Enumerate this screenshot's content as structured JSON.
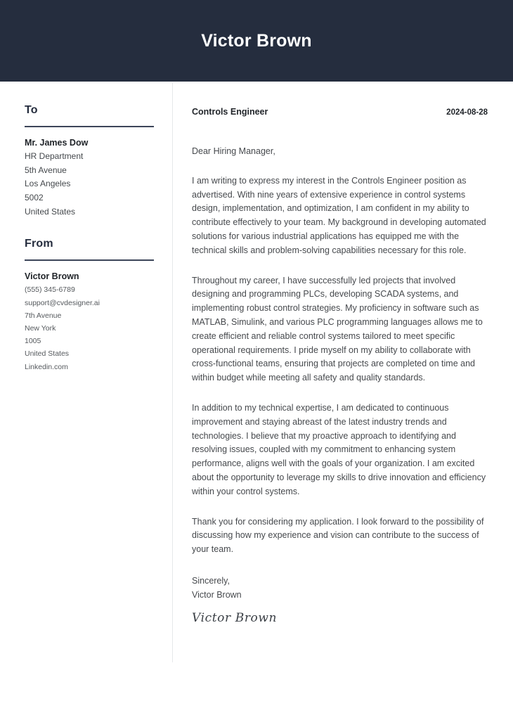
{
  "header": {
    "name": "Victor Brown"
  },
  "sidebar": {
    "to": {
      "heading": "To",
      "lines": [
        "Mr. James Dow",
        "HR Department",
        "5th Avenue",
        "Los Angeles",
        "5002",
        "United States"
      ]
    },
    "from": {
      "heading": "From",
      "name": "Victor Brown",
      "lines": [
        "(555) 345-6789",
        "support@cvdesigner.ai",
        "7th Avenue",
        "New York",
        "1005",
        "United States",
        "Linkedin.com"
      ]
    }
  },
  "letter": {
    "title": "Controls Engineer",
    "date": "2024-08-28",
    "salutation": "Dear Hiring Manager,",
    "paragraphs": [
      "I am writing to express my interest in the Controls Engineer position as advertised. With nine years of extensive experience in control systems design, implementation, and optimization, I am confident in my ability to contribute effectively to your team. My background in developing automated solutions for various industrial applications has equipped me with the technical skills and problem-solving capabilities necessary for this role.",
      "Throughout my career, I have successfully led projects that involved designing and programming PLCs, developing SCADA systems, and implementing robust control strategies. My proficiency in software such as MATLAB, Simulink, and various PLC programming languages allows me to create efficient and reliable control systems tailored to meet specific operational requirements. I pride myself on my ability to collaborate with cross-functional teams, ensuring that projects are completed on time and within budget while meeting all safety and quality standards.",
      "In addition to my technical expertise, I am dedicated to continuous improvement and staying abreast of the latest industry trends and technologies. I believe that my proactive approach to identifying and resolving issues, coupled with my commitment to enhancing system performance, aligns well with the goals of your organization. I am excited about the opportunity to leverage my skills to drive innovation and efficiency within your control systems.",
      "Thank you for considering my application. I look forward to the possibility of discussing how my experience and vision can contribute to the success of your team."
    ],
    "closing": "Sincerely,",
    "closing_name": "Victor Brown",
    "signature": "Victor Brown"
  },
  "colors": {
    "banner": "#252d3e",
    "rule": "#3c4559",
    "divider": "#e6e8ea",
    "body_text": "#46494d"
  }
}
